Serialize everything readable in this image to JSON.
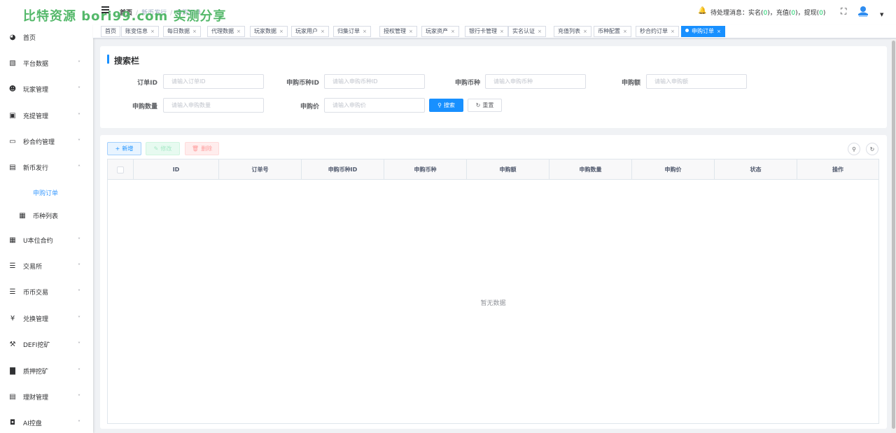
{
  "watermark": "比特资源 bori99.com 实测分享",
  "sidebar": {
    "items": [
      {
        "label": "首页",
        "icon": "dashboard-icon",
        "has_arrow": false
      },
      {
        "label": "平台数据",
        "icon": "data-icon",
        "has_arrow": true
      },
      {
        "label": "玩家管理",
        "icon": "user-icon",
        "has_arrow": true
      },
      {
        "label": "充提管理",
        "icon": "wallet-icon",
        "has_arrow": true
      },
      {
        "label": "秒合约管理",
        "icon": "monitor-icon",
        "has_arrow": true
      },
      {
        "label": "新币发行",
        "icon": "coin-icon",
        "has_arrow": true,
        "expanded": true
      },
      {
        "label": "申购订单",
        "icon": "",
        "has_arrow": false,
        "submenu": true,
        "active": true
      },
      {
        "label": "币种列表",
        "icon": "list-icon",
        "has_arrow": false,
        "submenu": true
      },
      {
        "label": "U本位合约",
        "icon": "grid-icon",
        "has_arrow": true
      },
      {
        "label": "交易所",
        "icon": "exchange-icon",
        "has_arrow": true
      },
      {
        "label": "币币交易",
        "icon": "trade-icon",
        "has_arrow": true
      },
      {
        "label": "兑换管理",
        "icon": "yen-icon",
        "has_arrow": true
      },
      {
        "label": "DEFI挖矿",
        "icon": "mining-icon",
        "has_arrow": true
      },
      {
        "label": "质押挖矿",
        "icon": "chart-bar-icon",
        "has_arrow": true
      },
      {
        "label": "理财管理",
        "icon": "finance-icon",
        "has_arrow": true
      },
      {
        "label": "AI控盘",
        "icon": "robot-icon",
        "has_arrow": true
      }
    ]
  },
  "header": {
    "breadcrumb": [
      "首页",
      "新币发行",
      "申购订单"
    ],
    "notice_label": "待处理消息：",
    "realname_label": "实名",
    "realname_count": "0",
    "recharge_label": "充值",
    "recharge_count": "0",
    "withdraw_label": "提现",
    "withdraw_count": "0"
  },
  "tags": [
    {
      "label": "首页",
      "closable": false
    },
    {
      "label": "账变信息",
      "closable": true
    },
    {
      "label": "每日数据",
      "closable": true
    },
    {
      "label": "代理数据",
      "closable": true
    },
    {
      "label": "玩家数据",
      "closable": true
    },
    {
      "label": "玩家用户",
      "closable": true
    },
    {
      "label": "归集订单",
      "closable": true
    },
    {
      "label": "授权管理",
      "closable": true
    },
    {
      "label": "玩家资产",
      "closable": true
    },
    {
      "label": "银行卡管理",
      "closable": true
    },
    {
      "label": "实名认证",
      "closable": true
    },
    {
      "label": "充值列表",
      "closable": true
    },
    {
      "label": "币种配置",
      "closable": true
    },
    {
      "label": "秒合约订单",
      "closable": true
    },
    {
      "label": "申购订单",
      "closable": true,
      "active": true
    }
  ],
  "search": {
    "title": "搜索栏",
    "fields": [
      {
        "label": "订单ID",
        "placeholder": "请输入订单ID"
      },
      {
        "label": "申购币种ID",
        "placeholder": "请输入申购币种ID"
      },
      {
        "label": "申购币种",
        "placeholder": "请输入申购币种"
      },
      {
        "label": "申购额",
        "placeholder": "请输入申购额"
      },
      {
        "label": "申购数量",
        "placeholder": "请输入申购数量"
      },
      {
        "label": "申购价",
        "placeholder": "请输入申购价"
      }
    ],
    "search_button": "搜索",
    "reset_button": "重置"
  },
  "toolbar": {
    "add": "新增",
    "edit": "修改",
    "delete": "删除"
  },
  "table": {
    "columns": [
      "ID",
      "订单号",
      "申购币种ID",
      "申购币种",
      "申购额",
      "申购数量",
      "申购价",
      "状态",
      "操作"
    ],
    "empty_text": "暂无数据"
  }
}
